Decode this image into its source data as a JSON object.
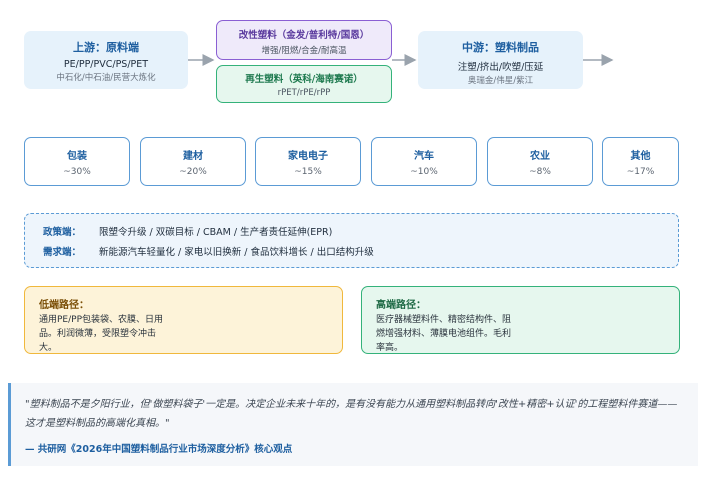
{
  "upstream": {
    "title": "上游：原料端",
    "products": "PE/PP/PVC/PS/PET",
    "companies": "中石化/中石油/民营大炼化"
  },
  "modified": {
    "title": "改性塑料（金发/普利特/国恩）",
    "desc": "增强/阻燃/合金/耐高温"
  },
  "recycled": {
    "title": "再生塑料（英科/海南赛诺）",
    "desc": "rPET/rPE/rPP"
  },
  "midstream": {
    "title": "中游：塑料制品",
    "processes": "注塑/挤出/吹塑/压延",
    "companies": "奥瑞金/伟星/紫江"
  },
  "applications": [
    {
      "name": "包装",
      "share": "~30%"
    },
    {
      "name": "建材",
      "share": "~20%"
    },
    {
      "name": "家电电子",
      "share": "~15%"
    },
    {
      "name": "汽车",
      "share": "~10%"
    },
    {
      "name": "农业",
      "share": "~8%"
    },
    {
      "name": "其他",
      "share": "~17%"
    }
  ],
  "drivers": {
    "policy_label": "政策端：",
    "policy_text": "限塑令升级 / 双碳目标 / CBAM / 生产者责任延伸(EPR)",
    "demand_label": "需求端：",
    "demand_text": "新能源汽车轻量化 / 家电以旧换新 / 食品饮料增长 / 出口结构升级"
  },
  "low_path": {
    "title": "低端路径：",
    "body": "通用PE/PP包装袋、农膜、日用品。利润微薄，受限塑令冲击大。"
  },
  "high_path": {
    "title": "高端路径：",
    "body": "医疗器械塑料件、精密结构件、阻燃增强材料、薄膜电池组件。毛利率高。"
  },
  "quote": {
    "text": "\"塑料制品不是夕阳行业，但'做塑料袋子'一定是。决定企业未来十年的，是有没有能力从通用塑料制品转向'改性+精密+认证'的工程塑料件赛道——这才是塑料制品的高端化真相。\"",
    "source": "— 共研网《2026年中国塑料制品行业市场深度分析》核心观点"
  },
  "colors": {
    "accent_blue": "#5b9bd5",
    "purple": "#8a5fd3",
    "green": "#34b27a",
    "amber": "#f0b83c"
  }
}
